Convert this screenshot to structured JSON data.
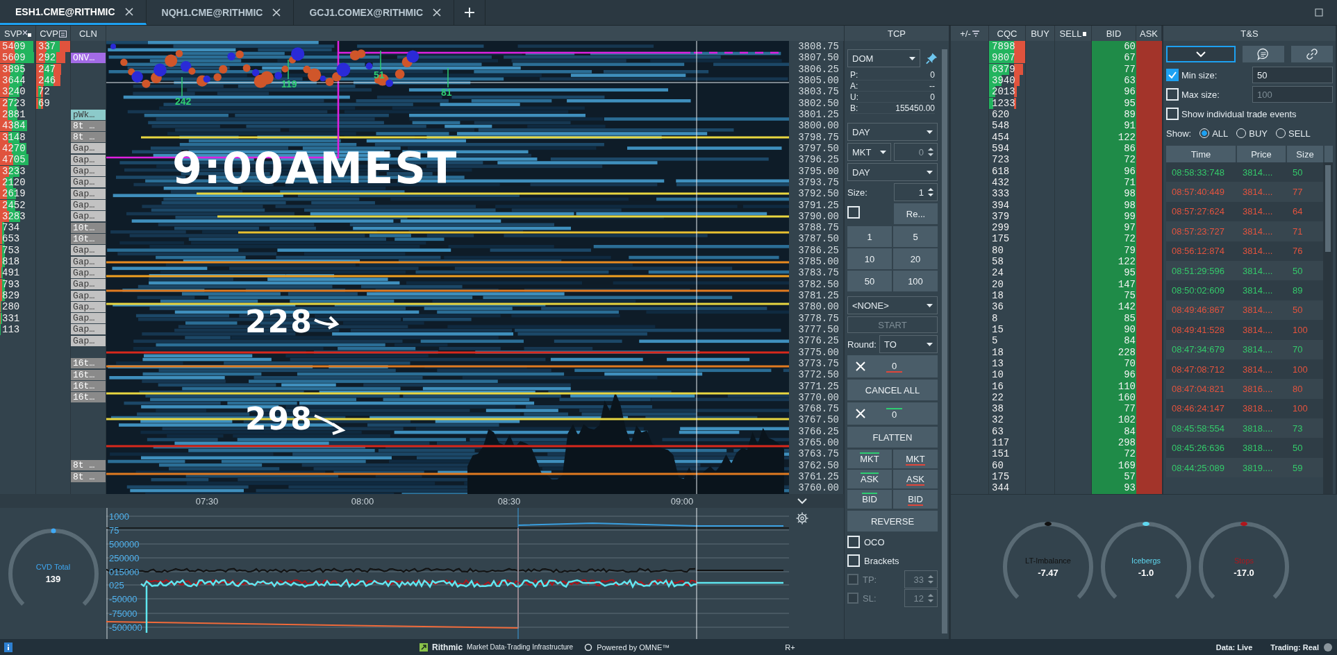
{
  "tabs": [
    {
      "label": "ESH1.CME@RITHMIC",
      "selected": true
    },
    {
      "label": "NQH1.CME@RITHMIC",
      "selected": false
    },
    {
      "label": "GCJ1.COMEX@RITHMIC",
      "selected": false
    }
  ],
  "left_headers": [
    "SVP",
    "CVP",
    "CLN"
  ],
  "ladder": [
    {
      "price": "3808.75",
      "svp": "5409",
      "cvp": "337",
      "cqc": "7898",
      "bid": "60"
    },
    {
      "price": "3807.50",
      "svp": "5609",
      "cvp": "292",
      "cln": {
        "label": "ONV…",
        "color": "#a36be6"
      },
      "cqc": "9807",
      "bid": "67"
    },
    {
      "price": "3806.25",
      "svp": "3895",
      "cvp": "247",
      "cqc": "6379",
      "bid": "77"
    },
    {
      "price": "3805.00",
      "svp": "3644",
      "cvp": "246",
      "cqc": "3940",
      "bid": "63"
    },
    {
      "price": "3803.75",
      "svp": "3240",
      "cvp": "72",
      "cqc": "2013",
      "bid": "96"
    },
    {
      "price": "3802.50",
      "svp": "2723",
      "cvp": "69",
      "cqc": "1233",
      "bid": "95"
    },
    {
      "price": "3801.25",
      "svp": "2881",
      "cln": {
        "label": "pWk…",
        "color": "#8ccaca"
      },
      "cqc": "620",
      "bid": "89"
    },
    {
      "price": "3800.00",
      "svp": "4384",
      "cln": {
        "label": "8t …",
        "color": "#8a8a8a"
      },
      "cqc": "548",
      "bid": "91"
    },
    {
      "price": "3798.75",
      "svp": "3148",
      "cln": {
        "label": "8t …",
        "color": "#8a8a8a"
      },
      "cqc": "454",
      "bid": "122"
    },
    {
      "price": "3797.50",
      "svp": "4270",
      "cln": {
        "label": "Gap…",
        "color": "#c2c2c2"
      },
      "cqc": "594",
      "bid": "86"
    },
    {
      "price": "3796.25",
      "svp": "4705",
      "cln": {
        "label": "Gap…",
        "color": "#c2c2c2"
      },
      "cqc": "723",
      "bid": "72"
    },
    {
      "price": "3795.00",
      "svp": "3233",
      "cln": {
        "label": "Gap…",
        "color": "#c2c2c2"
      },
      "cqc": "618",
      "bid": "96"
    },
    {
      "price": "3793.75",
      "svp": "2120",
      "cln": {
        "label": "Gap…",
        "color": "#c2c2c2"
      },
      "cqc": "432",
      "bid": "71"
    },
    {
      "price": "3792.50",
      "svp": "2619",
      "cln": {
        "label": "Gap…",
        "color": "#c2c2c2"
      },
      "cqc": "333",
      "bid": "98"
    },
    {
      "price": "3791.25",
      "svp": "2452",
      "cln": {
        "label": "Gap…",
        "color": "#c2c2c2"
      },
      "cqc": "394",
      "bid": "98"
    },
    {
      "price": "3790.00",
      "svp": "3283",
      "cln": {
        "label": "Gap…",
        "color": "#c2c2c2"
      },
      "cqc": "379",
      "bid": "99"
    },
    {
      "price": "3788.75",
      "svp": "734",
      "cln": {
        "label": "10t…",
        "color": "#8a8a8a"
      },
      "cqc": "299",
      "bid": "97"
    },
    {
      "price": "3787.50",
      "svp": "653",
      "cln": {
        "label": "10t…",
        "color": "#8a8a8a"
      },
      "cqc": "175",
      "bid": "72"
    },
    {
      "price": "3786.25",
      "svp": "753",
      "cln": {
        "label": "Gap…",
        "color": "#c2c2c2"
      },
      "cqc": "80",
      "bid": "79"
    },
    {
      "price": "3785.00",
      "svp": "818",
      "cln": {
        "label": "Gap…",
        "color": "#c2c2c2"
      },
      "cqc": "58",
      "bid": "122"
    },
    {
      "price": "3783.75",
      "svp": "491",
      "cln": {
        "label": "Gap…",
        "color": "#c2c2c2"
      },
      "cqc": "24",
      "bid": "95"
    },
    {
      "price": "3782.50",
      "svp": "793",
      "cln": {
        "label": "Gap…",
        "color": "#c2c2c2"
      },
      "cqc": "20",
      "bid": "147"
    },
    {
      "price": "3781.25",
      "svp": "829",
      "cln": {
        "label": "Gap…",
        "color": "#c2c2c2"
      },
      "cqc": "18",
      "bid": "75"
    },
    {
      "price": "3780.00",
      "svp": "280",
      "cln": {
        "label": "Gap…",
        "color": "#c2c2c2"
      },
      "cqc": "36",
      "bid": "142"
    },
    {
      "price": "3778.75",
      "svp": "331",
      "cln": {
        "label": "Gap…",
        "color": "#c2c2c2"
      },
      "cqc": "8",
      "bid": "85"
    },
    {
      "price": "3777.50",
      "svp": "113",
      "cln": {
        "label": "Gap…",
        "color": "#c2c2c2"
      },
      "cqc": "15",
      "bid": "90"
    },
    {
      "price": "3776.25",
      "cln": {
        "label": "Gap…",
        "color": "#c2c2c2"
      },
      "cqc": "5",
      "bid": "84"
    },
    {
      "price": "3775.00",
      "cqc": "18",
      "bid": "228"
    },
    {
      "price": "3773.75",
      "cln": {
        "label": "16t…",
        "color": "#8a8a8a"
      },
      "cqc": "13",
      "bid": "70"
    },
    {
      "price": "3772.50",
      "cln": {
        "label": "16t…",
        "color": "#8a8a8a"
      },
      "cqc": "10",
      "bid": "96"
    },
    {
      "price": "3771.25",
      "cln": {
        "label": "16t…",
        "color": "#8a8a8a"
      },
      "cqc": "16",
      "bid": "110"
    },
    {
      "price": "3770.00",
      "cln": {
        "label": "16t…",
        "color": "#8a8a8a"
      },
      "cqc": "22",
      "bid": "160"
    },
    {
      "price": "3768.75",
      "cqc": "38",
      "bid": "77"
    },
    {
      "price": "3767.50",
      "cqc": "32",
      "bid": "102"
    },
    {
      "price": "3766.25",
      "cqc": "63",
      "bid": "84"
    },
    {
      "price": "3765.00",
      "cqc": "117",
      "bid": "298"
    },
    {
      "price": "3763.75",
      "cqc": "151",
      "bid": "72"
    },
    {
      "price": "3762.50",
      "cln": {
        "label": "8t …",
        "color": "#8a8a8a"
      },
      "cqc": "60",
      "bid": "169"
    },
    {
      "price": "3761.25",
      "cln": {
        "label": "8t …",
        "color": "#8a8a8a"
      },
      "cqc": "175",
      "bid": "57"
    },
    {
      "price": "3760.00",
      "cqc": "344",
      "bid": "93"
    }
  ],
  "heatmap": {
    "labels": [
      "242",
      "119",
      "51",
      "81"
    ],
    "notes": [
      "9:00AMEST",
      "228",
      "298"
    ]
  },
  "time_axis": [
    "07:30",
    "08:00",
    "08:30",
    "09:00"
  ],
  "indicator_axis": [
    "1000",
    "75",
    "500000",
    "250000",
    "015000",
    "025",
    "-50000",
    "-75000",
    "-500000"
  ],
  "tcp": {
    "title": "TCP",
    "mode": "DOM",
    "account": [
      {
        "label": "P:",
        "value": "0"
      },
      {
        "label": "A:",
        "value": "--"
      },
      {
        "label": "U:",
        "value": "0"
      },
      {
        "label": "B:",
        "value": "155450.00"
      }
    ],
    "tif": "DAY",
    "order_type": "MKT",
    "price": "0",
    "tif_2": "DAY",
    "size_label": "Size:",
    "size": "1",
    "reset": {
      "checked": false,
      "label": "Re..."
    },
    "quantities": [
      "1",
      "5",
      "10",
      "20",
      "50",
      "100"
    ],
    "strategy": "<NONE>",
    "start": {
      "label": "START",
      "disabled": true
    },
    "round_label": "Round:",
    "round": "TO",
    "cancel_sell": "0",
    "cancel_all": "CANCEL ALL",
    "cancel_buy": "0",
    "flatten": "FLATTEN",
    "orders": [
      {
        "label": "MKT",
        "kind": "buy"
      },
      {
        "label": "MKT",
        "kind": "sell"
      },
      {
        "label": "ASK",
        "kind": "buy"
      },
      {
        "label": "ASK",
        "kind": "sell"
      },
      {
        "label": "BID",
        "kind": "buy"
      },
      {
        "label": "BID",
        "kind": "sell"
      }
    ],
    "reverse": "REVERSE",
    "options": [
      {
        "label": "OCO",
        "checked": false
      },
      {
        "label": "Brackets",
        "checked": false
      }
    ],
    "brackets": [
      {
        "label": "TP:",
        "value": "33",
        "disabled": true
      },
      {
        "label": "SL:",
        "value": "12",
        "disabled": true
      }
    ]
  },
  "dom_headers": [
    "+/-",
    "CQC",
    "BUY",
    "SELL",
    "BID",
    "ASK"
  ],
  "ts": {
    "title": "T&S",
    "min_size": {
      "label": "Min size:",
      "checked": true,
      "value": "50"
    },
    "max_size": {
      "label": "Max size:",
      "checked": false,
      "placeholder": "100"
    },
    "individual": {
      "label": "Show individual trade events",
      "checked": false
    },
    "show_label": "Show:",
    "show": [
      {
        "label": "ALL",
        "selected": true
      },
      {
        "label": "BUY",
        "selected": false
      },
      {
        "label": "SELL",
        "selected": false
      }
    ],
    "columns": [
      "Time",
      "Price",
      "Size"
    ],
    "trades": [
      {
        "time": "08:58:33:748",
        "price": "3814....",
        "size": "50",
        "kind": "buy"
      },
      {
        "time": "08:57:40:449",
        "price": "3814....",
        "size": "77",
        "kind": "sell"
      },
      {
        "time": "08:57:27:624",
        "price": "3814....",
        "size": "64",
        "kind": "sell"
      },
      {
        "time": "08:57:23:727",
        "price": "3814....",
        "size": "71",
        "kind": "sell"
      },
      {
        "time": "08:56:12:874",
        "price": "3814....",
        "size": "76",
        "kind": "sell"
      },
      {
        "time": "08:51:29:596",
        "price": "3814....",
        "size": "50",
        "kind": "buy"
      },
      {
        "time": "08:50:02:609",
        "price": "3814....",
        "size": "89",
        "kind": "buy"
      },
      {
        "time": "08:49:46:867",
        "price": "3814....",
        "size": "50",
        "kind": "sell"
      },
      {
        "time": "08:49:41:528",
        "price": "3814....",
        "size": "100",
        "kind": "sell"
      },
      {
        "time": "08:47:34:679",
        "price": "3814....",
        "size": "70",
        "kind": "buy"
      },
      {
        "time": "08:47:08:712",
        "price": "3814....",
        "size": "100",
        "kind": "sell"
      },
      {
        "time": "08:47:04:821",
        "price": "3816....",
        "size": "80",
        "kind": "sell"
      },
      {
        "time": "08:46:24:147",
        "price": "3818....",
        "size": "100",
        "kind": "sell"
      },
      {
        "time": "08:45:58:554",
        "price": "3818....",
        "size": "73",
        "kind": "buy"
      },
      {
        "time": "08:45:26:636",
        "price": "3818....",
        "size": "50",
        "kind": "buy"
      },
      {
        "time": "08:44:25:089",
        "price": "3819....",
        "size": "59",
        "kind": "buy"
      }
    ]
  },
  "gauges": [
    {
      "title": "CVD Total",
      "value": "139",
      "color": "#3fa9f5",
      "level": 0.5
    },
    {
      "title": "LT-Imbalance",
      "value": "-7.47",
      "color": "#111111",
      "level": 0.5
    },
    {
      "title": "Icebergs",
      "value": "-1.0",
      "color": "#5fd8f0",
      "level": 0.5
    },
    {
      "title": "Stops",
      "value": "-17.0",
      "color": "#b0161c",
      "level": 0.5
    }
  ],
  "status": {
    "brand": "Rithmic",
    "tagline": "Market Data·Trading Infrastructure",
    "powered": "Powered by OMNE™",
    "mode": "R+",
    "data": "Data: Live",
    "trading": "Trading: Real"
  }
}
